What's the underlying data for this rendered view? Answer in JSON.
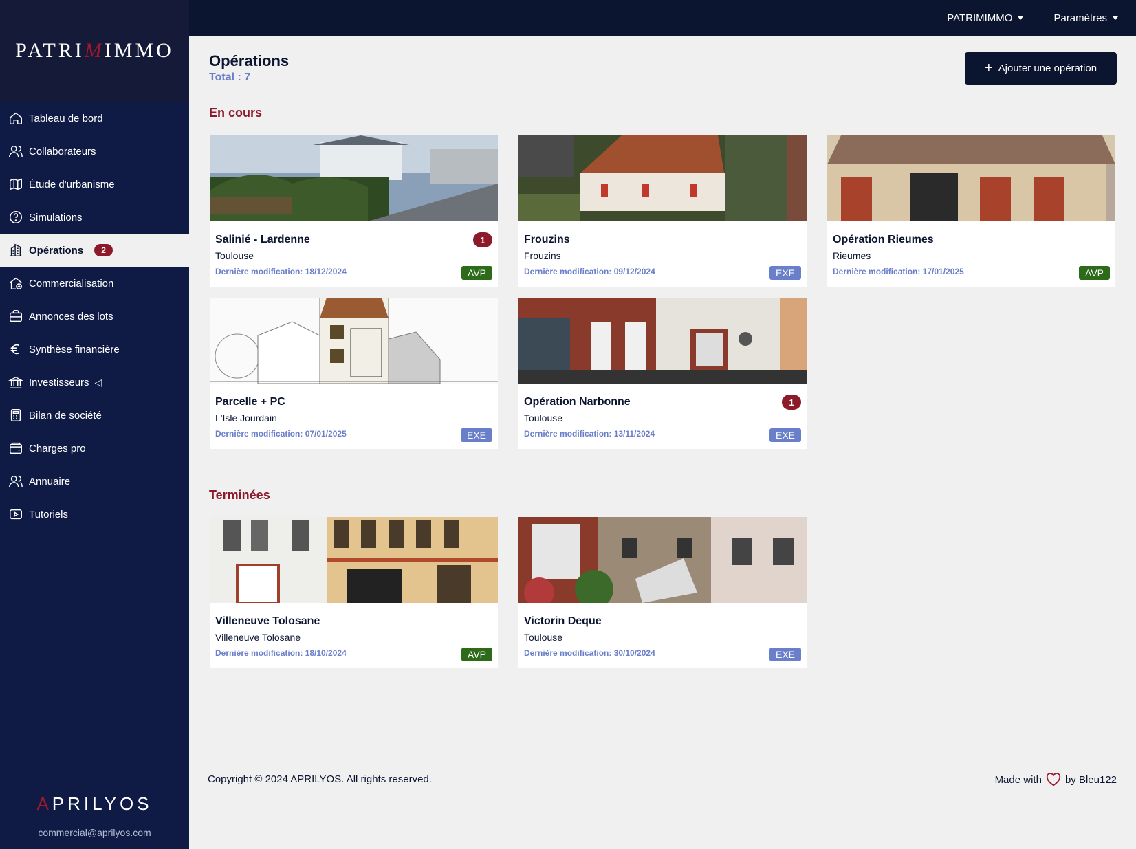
{
  "brand": {
    "logo_left": "PATRI",
    "logo_m": "M",
    "logo_right": "IMMO",
    "footer_logo_a": "A",
    "footer_logo_rest": "PRILYOS",
    "email": "commercial@aprilyos.com"
  },
  "topbar": {
    "company_menu": "PATRIMIMMO",
    "settings_menu": "Paramètres"
  },
  "sidebar": {
    "items": [
      {
        "label": "Tableau de bord",
        "icon": "home-icon"
      },
      {
        "label": "Collaborateurs",
        "icon": "users-icon"
      },
      {
        "label": "Étude d'urbanisme",
        "icon": "map-icon"
      },
      {
        "label": "Simulations",
        "icon": "question-icon"
      },
      {
        "label": "Opérations",
        "icon": "building-icon",
        "badge": "2",
        "active": true
      },
      {
        "label": "Commercialisation",
        "icon": "house-sale-icon"
      },
      {
        "label": "Annonces des lots",
        "icon": "briefcase-icon"
      },
      {
        "label": "Synthèse financière",
        "icon": "euro-icon"
      },
      {
        "label": "Investisseurs",
        "icon": "bank-icon",
        "caret": "◁"
      },
      {
        "label": "Bilan de société",
        "icon": "calculator-icon"
      },
      {
        "label": "Charges pro",
        "icon": "wallet-icon"
      },
      {
        "label": "Annuaire",
        "icon": "contacts-icon"
      },
      {
        "label": "Tutoriels",
        "icon": "play-icon"
      }
    ]
  },
  "header": {
    "title": "Opérations",
    "total": "Total : 7",
    "add_button": "Ajouter une opération"
  },
  "sections": {
    "in_progress": "En cours",
    "finished": "Terminées"
  },
  "operations_in_progress": [
    {
      "title": "Salinié - Lardenne",
      "city": "Toulouse",
      "date": "Dernière modification: 18/12/2024",
      "phase": "AVP",
      "count": "1"
    },
    {
      "title": "Frouzins",
      "city": "Frouzins",
      "date": "Dernière modification: 09/12/2024",
      "phase": "EXE"
    },
    {
      "title": "Opération Rieumes",
      "city": "Rieumes",
      "date": "Dernière modification: 17/01/2025",
      "phase": "AVP"
    },
    {
      "title": "Parcelle + PC",
      "city": "L'Isle Jourdain",
      "date": "Dernière modification: 07/01/2025",
      "phase": "EXE"
    },
    {
      "title": "Opération Narbonne",
      "city": "Toulouse",
      "date": "Dernière modification: 13/11/2024",
      "phase": "EXE",
      "count": "1"
    }
  ],
  "operations_finished": [
    {
      "title": "Villeneuve Tolosane",
      "city": "Villeneuve Tolosane",
      "date": "Dernière modification: 18/10/2024",
      "phase": "AVP"
    },
    {
      "title": "Victorin Deque",
      "city": "Toulouse",
      "date": "Dernière modification: 30/10/2024",
      "phase": "EXE"
    }
  ],
  "footer": {
    "copyright": "Copyright © 2024 APRILYOS. All rights reserved.",
    "made_with": "Made with",
    "by": "by Bleu122"
  },
  "colors": {
    "navy": "#0c1530",
    "sidebar": "#0f1a45",
    "accent_red": "#8c1a2b",
    "link_blue": "#6a7fc9",
    "avp_green": "#2d6a1a"
  }
}
